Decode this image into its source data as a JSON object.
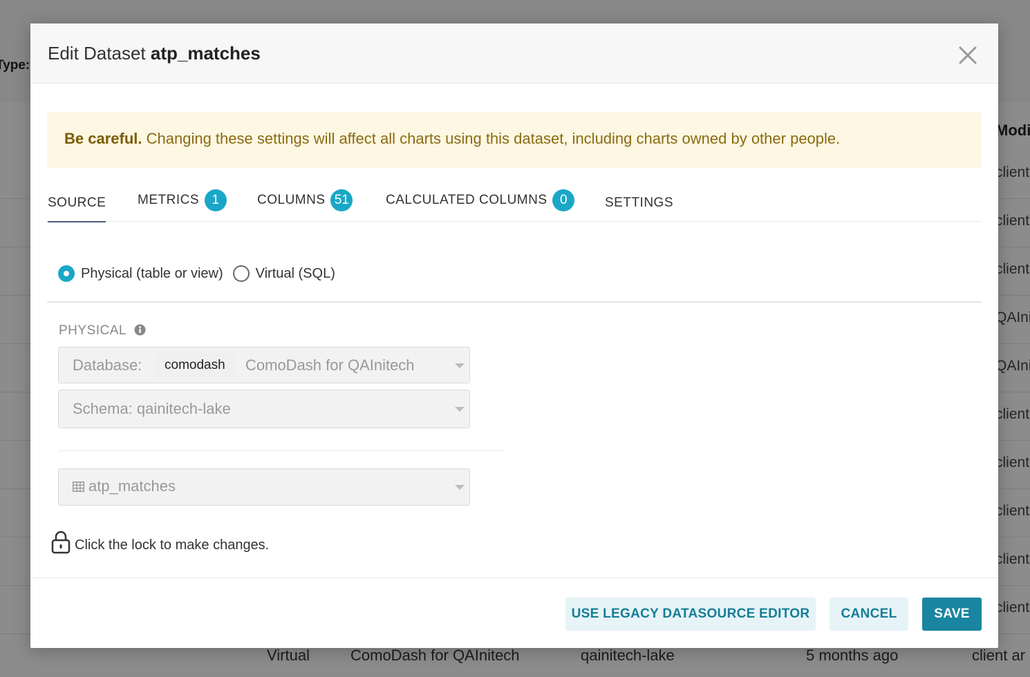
{
  "background": {
    "type_label": "Type:",
    "modified_label": "Modified",
    "row_snippets": [
      "client ar",
      "client ar",
      "client ar",
      "QAInitech Q",
      "QAInitech Q",
      "client ar",
      "client ar",
      "client ar",
      "client ar",
      "client ar"
    ],
    "bottom_row": {
      "kind": "Virtual",
      "database": "ComoDash for QAInitech",
      "schema": "qainitech-lake",
      "modified": "5 months ago",
      "owner": "client ar"
    }
  },
  "modal": {
    "title_prefix": "Edit Dataset",
    "title_name": "atp_matches",
    "alert": {
      "strong": "Be careful.",
      "text": "Changing these settings will affect all charts using this dataset, including charts owned by other people."
    },
    "tabs": [
      {
        "label": "SOURCE",
        "active": true
      },
      {
        "label": "METRICS",
        "count": "1"
      },
      {
        "label": "COLUMNS",
        "count": "51"
      },
      {
        "label": "CALCULATED COLUMNS",
        "count": "0"
      },
      {
        "label": "SETTINGS"
      }
    ],
    "source_type": {
      "physical_label": "Physical (table or view)",
      "virtual_label": "Virtual (SQL)",
      "selected": "physical"
    },
    "physical": {
      "header": "PHYSICAL",
      "database_prefix": "Database:",
      "database_backend": "comodash",
      "database_name": "ComoDash for QAInitech",
      "schema": "Schema: qainitech-lake",
      "table": "atp_matches"
    },
    "lock_text": "Click the lock to make changes.",
    "footer": {
      "legacy_label": "USE LEGACY DATASOURCE EDITOR",
      "cancel_label": "CANCEL",
      "save_label": "SAVE"
    }
  },
  "colors": {
    "accent": "#1aa7c7",
    "primary_button": "#1a85a0",
    "alert_bg": "#fdf7e3",
    "alert_text": "#8b6b10"
  }
}
